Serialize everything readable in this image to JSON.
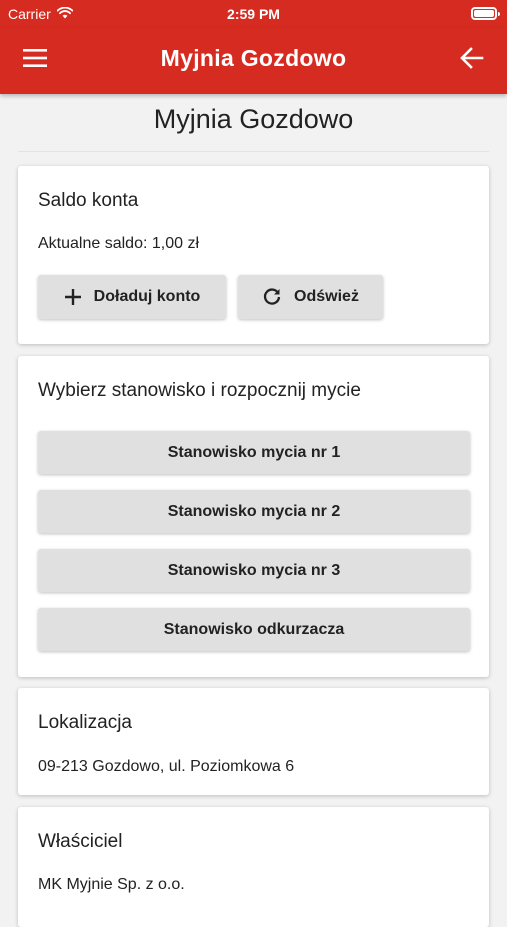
{
  "status_bar": {
    "carrier": "Carrier",
    "time": "2:59 PM"
  },
  "app_bar": {
    "title": "Myjnia Gozdowo",
    "color": "#d62b20"
  },
  "page": {
    "title": "Myjnia Gozdowo"
  },
  "balance_card": {
    "heading": "Saldo konta",
    "balance_text": "Aktualne saldo: 1,00 zł",
    "topup_label": "Doładuj konto",
    "refresh_label": "Odśwież"
  },
  "stations_card": {
    "heading": "Wybierz stanowisko i rozpocznij mycie",
    "stations": [
      "Stanowisko mycia nr 1",
      "Stanowisko mycia nr 2",
      "Stanowisko mycia nr 3",
      "Stanowisko odkurzacza"
    ]
  },
  "location_card": {
    "heading": "Lokalizacja",
    "address": "09-213 Gozdowo, ul. Poziomkowa 6"
  },
  "owner_card": {
    "heading": "Właściciel",
    "line1": "MK Myjnie Sp. z o.o."
  }
}
